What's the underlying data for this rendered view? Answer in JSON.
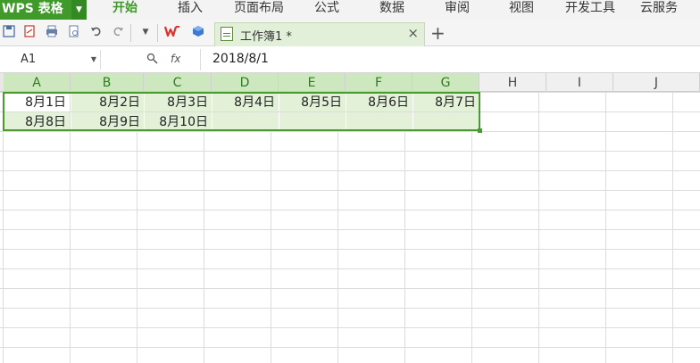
{
  "app": {
    "logo": "WPS 表格"
  },
  "menu": [
    {
      "label": "开始",
      "active": true
    },
    {
      "label": "插入"
    },
    {
      "label": "页面布局"
    },
    {
      "label": "公式"
    },
    {
      "label": "数据"
    },
    {
      "label": "审阅"
    },
    {
      "label": "视图"
    },
    {
      "label": "开发工具"
    },
    {
      "label": "云服务"
    }
  ],
  "tab": {
    "title": "工作簿1 *"
  },
  "formula": {
    "cell_ref": "A1",
    "fx": "fx",
    "content": "2018/8/1"
  },
  "columns": [
    "A",
    "B",
    "C",
    "D",
    "E",
    "F",
    "G",
    "H",
    "I",
    "J"
  ],
  "rows": [
    [
      "8月1日",
      "8月2日",
      "8月3日",
      "8月4日",
      "8月5日",
      "8月6日",
      "8月7日"
    ],
    [
      "8月8日",
      "8月9日",
      "8月10日"
    ]
  ],
  "colors": {
    "accent": "#3f9a2a",
    "selection": "#e2f1d8",
    "header_selected": "#cde8be"
  }
}
